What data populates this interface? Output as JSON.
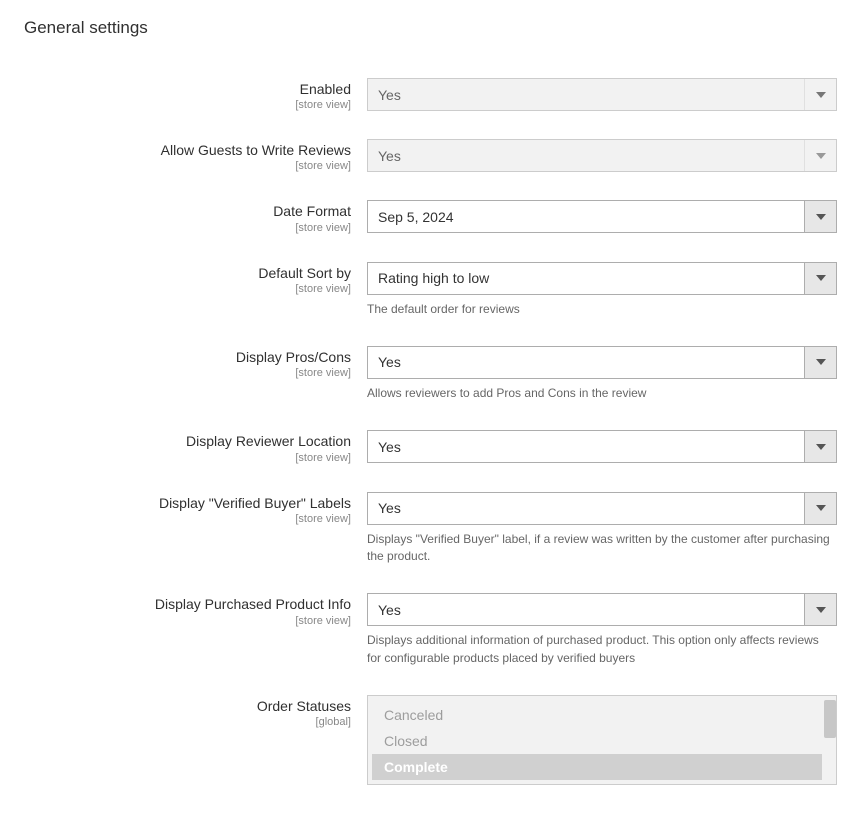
{
  "page": {
    "title": "General settings"
  },
  "scope": {
    "storeview": "[store view]",
    "global": "[global]"
  },
  "fields": {
    "enabled": {
      "label": "Enabled",
      "value": "Yes"
    },
    "allowGuests": {
      "label": "Allow Guests to Write Reviews",
      "value": "Yes"
    },
    "dateFormat": {
      "label": "Date Format",
      "value": "Sep 5, 2024"
    },
    "defaultSort": {
      "label": "Default Sort by",
      "value": "Rating high to low",
      "note": "The default order for reviews"
    },
    "displayProsCons": {
      "label": "Display Pros/Cons",
      "value": "Yes",
      "note": "Allows reviewers to add Pros and Cons in the review"
    },
    "displayReviewerLocation": {
      "label": "Display Reviewer Location",
      "value": "Yes"
    },
    "displayVerifiedBuyer": {
      "label": "Display \"Verified Buyer\" Labels",
      "value": "Yes",
      "note": "Displays \"Verified Buyer\" label, if a review was written by the customer after purchasing the product."
    },
    "displayPurchasedInfo": {
      "label": "Display Purchased Product Info",
      "value": "Yes",
      "note": "Displays additional information of purchased product. This option only affects reviews for configurable products placed by verified buyers"
    },
    "orderStatuses": {
      "label": "Order Statuses",
      "options": [
        {
          "label": "Canceled",
          "selected": false
        },
        {
          "label": "Closed",
          "selected": false
        },
        {
          "label": "Complete",
          "selected": true
        }
      ]
    }
  }
}
